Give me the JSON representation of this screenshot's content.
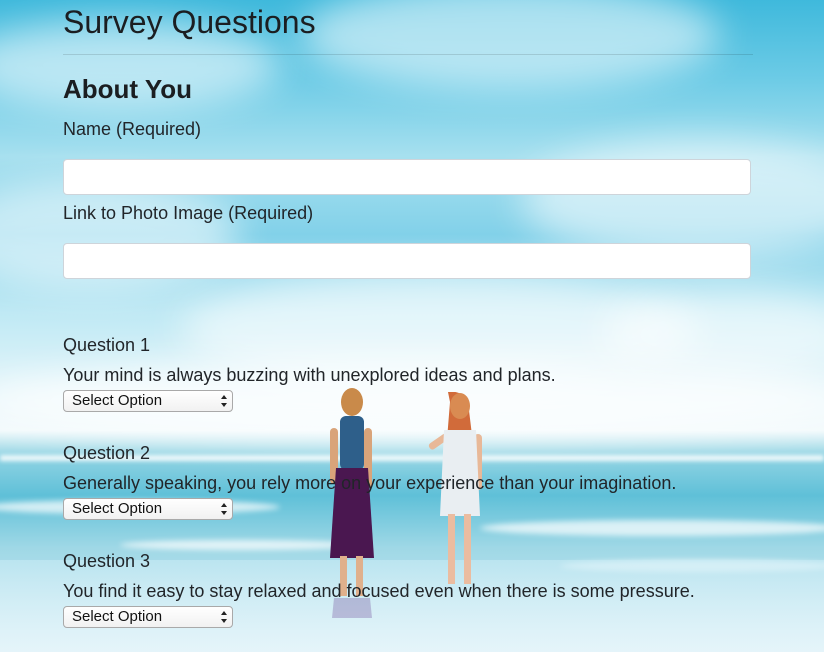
{
  "header": {
    "title": "Survey Questions"
  },
  "about": {
    "section_title": "About You",
    "name_label": "Name (Required)",
    "name_value": "",
    "photo_label": "Link to Photo Image (Required)",
    "photo_value": ""
  },
  "questions": [
    {
      "label": "Question 1",
      "text": "Your mind is always buzzing with unexplored ideas and plans.",
      "selected": "Select Option"
    },
    {
      "label": "Question 2",
      "text": "Generally speaking, you rely more on your experience than your imagination.",
      "selected": "Select Option"
    },
    {
      "label": "Question 3",
      "text": "You find it easy to stay relaxed and focused even when there is some pressure.",
      "selected": "Select Option"
    }
  ],
  "colors": {
    "sky": "#6ccbe6",
    "sea": "#5fc0d8",
    "text": "#212529"
  }
}
